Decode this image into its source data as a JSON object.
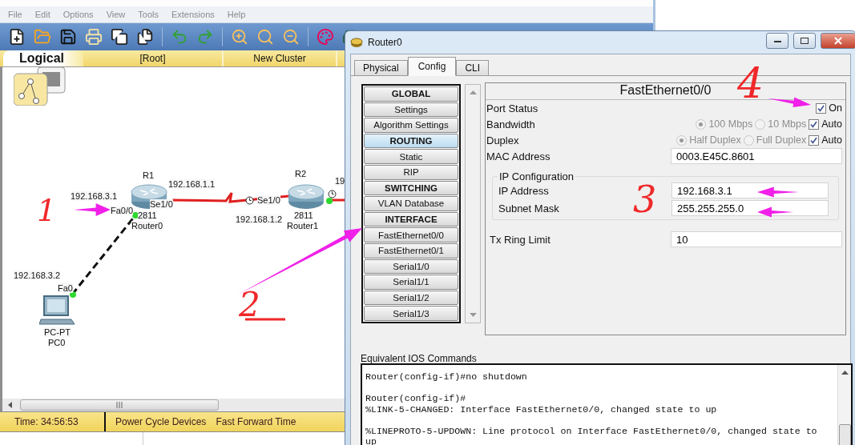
{
  "main_window": {
    "menu": [
      "File",
      "Edit",
      "Options",
      "View",
      "Tools",
      "Extensions",
      "Help"
    ],
    "workspace_bar": {
      "mode": "Logical",
      "path": "[Root]",
      "action": "New Cluster"
    },
    "diagram": {
      "labels": [
        "R1",
        "192.168.1.1",
        "192.168.3.1",
        "Fa0/0",
        "Se1/0",
        "2811",
        "Router0",
        "R2",
        "Se1/0",
        "192.168.1.2",
        "2811",
        "Router1",
        "19",
        "192.168.3.2",
        "Fa0",
        "PC-PT",
        "PC0"
      ]
    },
    "status_bar": {
      "time": "Time: 34:56:53",
      "buttons": [
        "Power Cycle Devices",
        "Fast Forward Time"
      ]
    }
  },
  "dialog": {
    "title": "Router0",
    "tabs": [
      {
        "label": "Physical",
        "selected": false
      },
      {
        "label": "Config",
        "selected": true
      },
      {
        "label": "CLI",
        "selected": false
      }
    ],
    "nav": [
      {
        "label": "GLOBAL",
        "kind": "header",
        "highlighted": false
      },
      {
        "label": "Settings",
        "kind": "item",
        "highlighted": false
      },
      {
        "label": "Algorithm Settings",
        "kind": "item",
        "highlighted": false
      },
      {
        "label": "ROUTING",
        "kind": "header",
        "highlighted": true
      },
      {
        "label": "Static",
        "kind": "item",
        "highlighted": false
      },
      {
        "label": "RIP",
        "kind": "item",
        "highlighted": false
      },
      {
        "label": "SWITCHING",
        "kind": "header",
        "highlighted": false
      },
      {
        "label": "VLAN Database",
        "kind": "item",
        "highlighted": false
      },
      {
        "label": "INTERFACE",
        "kind": "header",
        "highlighted": false
      },
      {
        "label": "FastEthernet0/0",
        "kind": "item",
        "highlighted": false
      },
      {
        "label": "FastEthernet0/1",
        "kind": "item",
        "highlighted": false
      },
      {
        "label": "Serial1/0",
        "kind": "item",
        "highlighted": false
      },
      {
        "label": "Serial1/1",
        "kind": "item",
        "highlighted": false
      },
      {
        "label": "Serial1/2",
        "kind": "item",
        "highlighted": false
      },
      {
        "label": "Serial1/3",
        "kind": "item",
        "highlighted": false
      }
    ],
    "panel": {
      "title": "FastEthernet0/0",
      "port_status": {
        "label": "Port Status",
        "on_label": "On",
        "checked": true
      },
      "bandwidth": {
        "label": "Bandwidth",
        "disabled": true,
        "options": [
          {
            "label": "100 Mbps",
            "selected": true
          },
          {
            "label": "10 Mbps",
            "selected": false
          }
        ],
        "auto_label": "Auto",
        "auto": true
      },
      "duplex": {
        "label": "Duplex",
        "disabled": true,
        "options": [
          {
            "label": "Half Duplex",
            "selected": true
          },
          {
            "label": "Full Duplex",
            "selected": false
          }
        ],
        "auto_label": "Auto",
        "auto": true
      },
      "mac": {
        "label": "MAC Address",
        "value": "0003.E45C.8601"
      },
      "ip_config": {
        "title": "IP Configuration",
        "fields": [
          {
            "label": "IP Address",
            "value": "192.168.3.1"
          },
          {
            "label": "Subnet Mask",
            "value": "255.255.255.0"
          }
        ]
      },
      "tx_ring": {
        "label": "Tx Ring Limit",
        "value": "10"
      }
    },
    "ios": {
      "label": "Equivalent IOS Commands",
      "blocks": [
        {
          "lines": [
            "Router(config-if)#no shutdown"
          ]
        },
        {
          "lines": [
            "Router(config-if)#",
            "%LINK-5-CHANGED: Interface FastEthernet0/0, changed state to up"
          ]
        },
        {
          "lines": [
            "%LINEPROTO-5-UPDOWN: Line protocol on Interface FastEthernet0/0, changed state to",
            "up"
          ]
        }
      ]
    }
  },
  "annotations": [
    {
      "label": "1"
    },
    {
      "label": "2"
    },
    {
      "label": "3"
    },
    {
      "label": "4"
    }
  ]
}
